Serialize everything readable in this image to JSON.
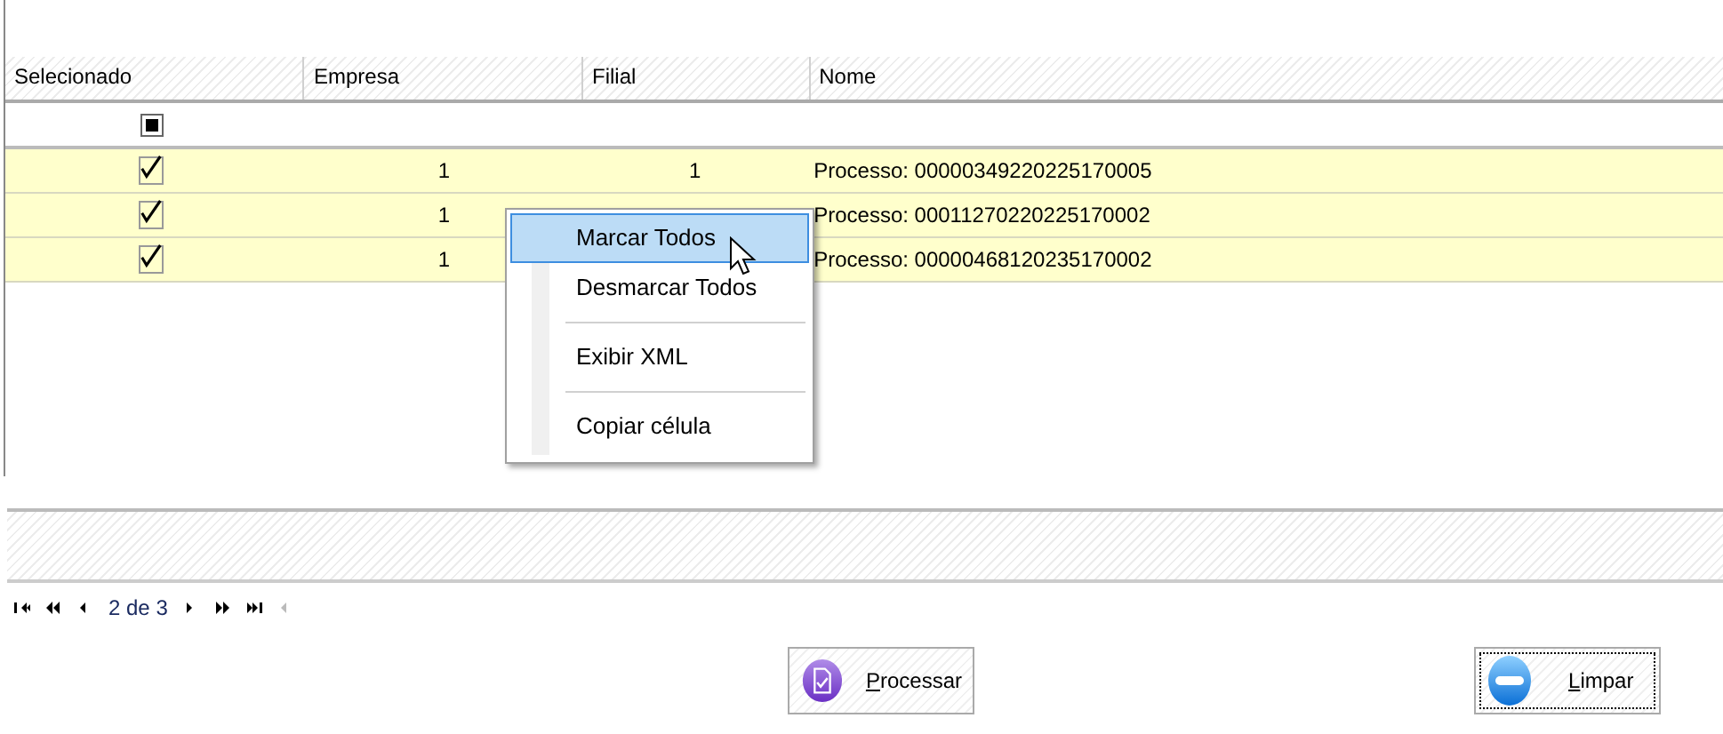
{
  "grid": {
    "columns": [
      "Selecionado",
      "Empresa",
      "Filial",
      "Nome"
    ],
    "filter_checkbox": {
      "indeterminate": true
    },
    "rows": [
      {
        "checked": true,
        "empresa": "1",
        "filial": "1",
        "nome": "Processo: 00000349220225170005"
      },
      {
        "checked": true,
        "empresa": "1",
        "nome": "Processo: 00011270220225170002"
      },
      {
        "checked": true,
        "empresa": "1",
        "nome": "Processo: 00000468120235170002"
      }
    ]
  },
  "context_menu": {
    "items": [
      {
        "kind": "item",
        "label": "Marcar Todos",
        "selected": true
      },
      {
        "kind": "item",
        "label": "Desmarcar Todos",
        "selected": false
      },
      {
        "kind": "separator"
      },
      {
        "kind": "item",
        "label": "Exibir XML",
        "selected": false
      },
      {
        "kind": "separator"
      },
      {
        "kind": "item",
        "label": "Copiar célula",
        "selected": false
      }
    ]
  },
  "pager": {
    "items": [
      {
        "kind": "first"
      },
      {
        "kind": "prev_page"
      },
      {
        "kind": "prev"
      },
      {
        "kind": "label",
        "text": "2 de 3"
      },
      {
        "kind": "next"
      },
      {
        "kind": "next_page"
      },
      {
        "kind": "last"
      },
      {
        "kind": "scroll_left"
      }
    ]
  },
  "buttons": [
    {
      "kind": "process",
      "label": "Processar",
      "focused": false
    },
    {
      "kind": "clear",
      "label": "Limpar",
      "focused": true
    }
  ]
}
